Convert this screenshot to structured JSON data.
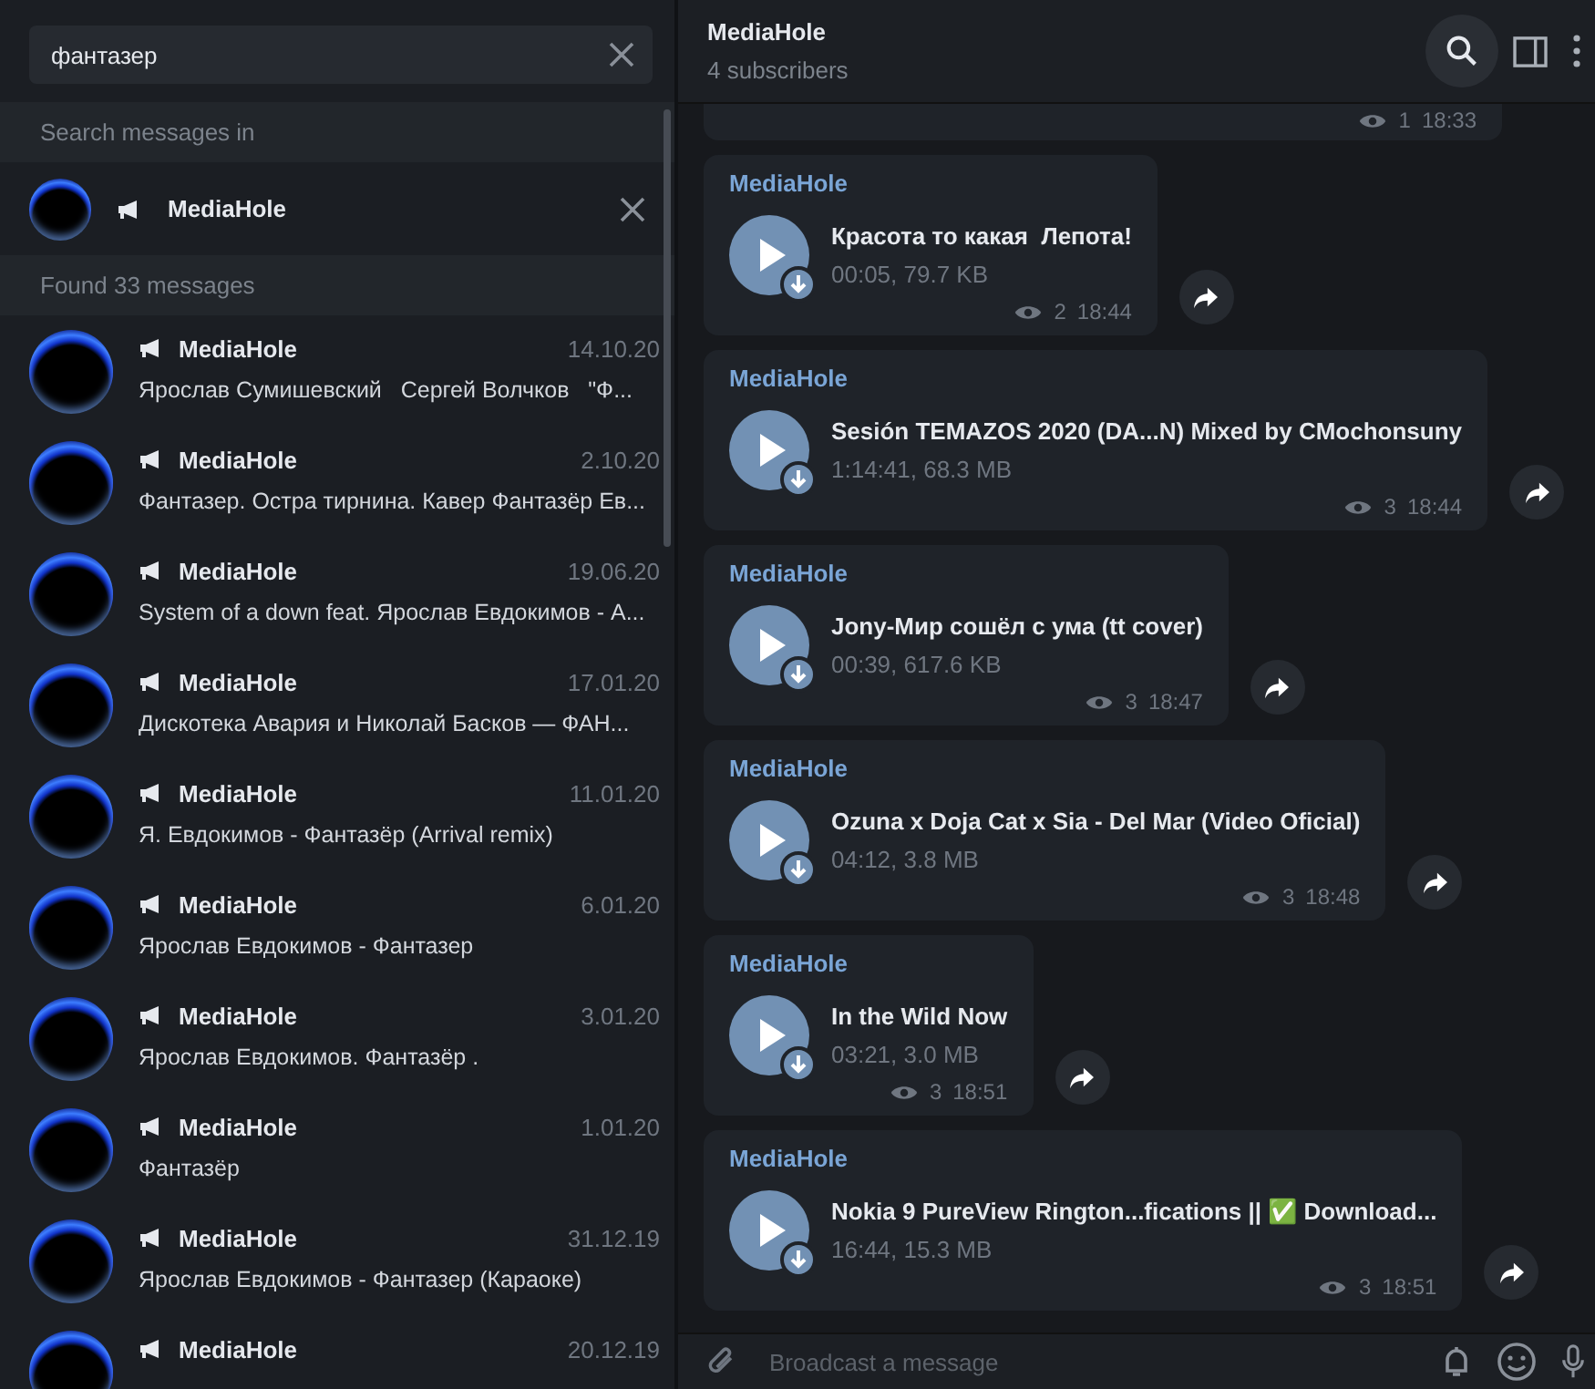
{
  "search": {
    "value": "фантазер"
  },
  "search_in": {
    "label": "Search messages in",
    "chat": {
      "name": "MediaHole"
    }
  },
  "found_label": "Found 33 messages",
  "results": [
    {
      "name": "MediaHole",
      "date": "14.10.20",
      "snippet": "Ярослав Сумишевский   Сергей Волчков   \"Ф...",
      "selected": false
    },
    {
      "name": "MediaHole",
      "date": "2.10.20",
      "snippet": "Фантазер. Остра тирнина. Кавер Фантазёр Ев...",
      "selected": false
    },
    {
      "name": "MediaHole",
      "date": "19.06.20",
      "snippet": "System of a down feat. Ярослав Евдокимов - А...",
      "selected": false
    },
    {
      "name": "MediaHole",
      "date": "17.01.20",
      "snippet": "Дискотека Авария и Николай Басков — ФАН...",
      "selected": false
    },
    {
      "name": "MediaHole",
      "date": "11.01.20",
      "snippet": "Я. Евдокимов - Фантазёр (Arrival remix)",
      "selected": false
    },
    {
      "name": "MediaHole",
      "date": "6.01.20",
      "snippet": "Ярослав Евдокимов - Фантазер",
      "selected": false
    },
    {
      "name": "MediaHole",
      "date": "3.01.20",
      "snippet": "Ярослав Евдокимов. Фантазёр .",
      "selected": false
    },
    {
      "name": "MediaHole",
      "date": "1.01.20",
      "snippet": "Фантазёр",
      "selected": false
    },
    {
      "name": "MediaHole",
      "date": "31.12.19",
      "snippet": "Ярослав Евдокимов - Фантазер (Караоке)",
      "selected": false
    },
    {
      "name": "MediaHole",
      "date": "20.12.19",
      "selected": false
    }
  ],
  "chat_header": {
    "title": "MediaHole",
    "subtitle": "4 subscribers"
  },
  "previous_message": {
    "views": "1",
    "time": "18:33"
  },
  "messages": [
    {
      "sender": "MediaHole",
      "title": "Красота то какая  Лепота!",
      "meta": "00:05, 79.7 KB",
      "views": "2",
      "time": "18:44"
    },
    {
      "sender": "MediaHole",
      "title": "Sesión TEMAZOS 2020 (DA...N) Mixed by CMochonsuny",
      "meta": "1:14:41, 68.3 MB",
      "views": "3",
      "time": "18:44"
    },
    {
      "sender": "MediaHole",
      "title": "Jony-Мир сошёл с ума (tt cover)",
      "meta": "00:39, 617.6 KB",
      "views": "3",
      "time": "18:47"
    },
    {
      "sender": "MediaHole",
      "title": "Ozuna x Doja Cat x Sia - Del Mar (Video Oficial)",
      "meta": "04:12, 3.8 MB",
      "views": "3",
      "time": "18:48"
    },
    {
      "sender": "MediaHole",
      "title": "In the Wild Now",
      "meta": "03:21, 3.0 MB",
      "views": "3",
      "time": "18:51"
    },
    {
      "sender": "MediaHole",
      "title": "Nokia 9 PureView Rington...fications || ✅ Download...",
      "meta": "16:44, 15.3 MB",
      "views": "3",
      "time": "18:51"
    }
  ],
  "composer": {
    "placeholder": "Broadcast a message"
  }
}
